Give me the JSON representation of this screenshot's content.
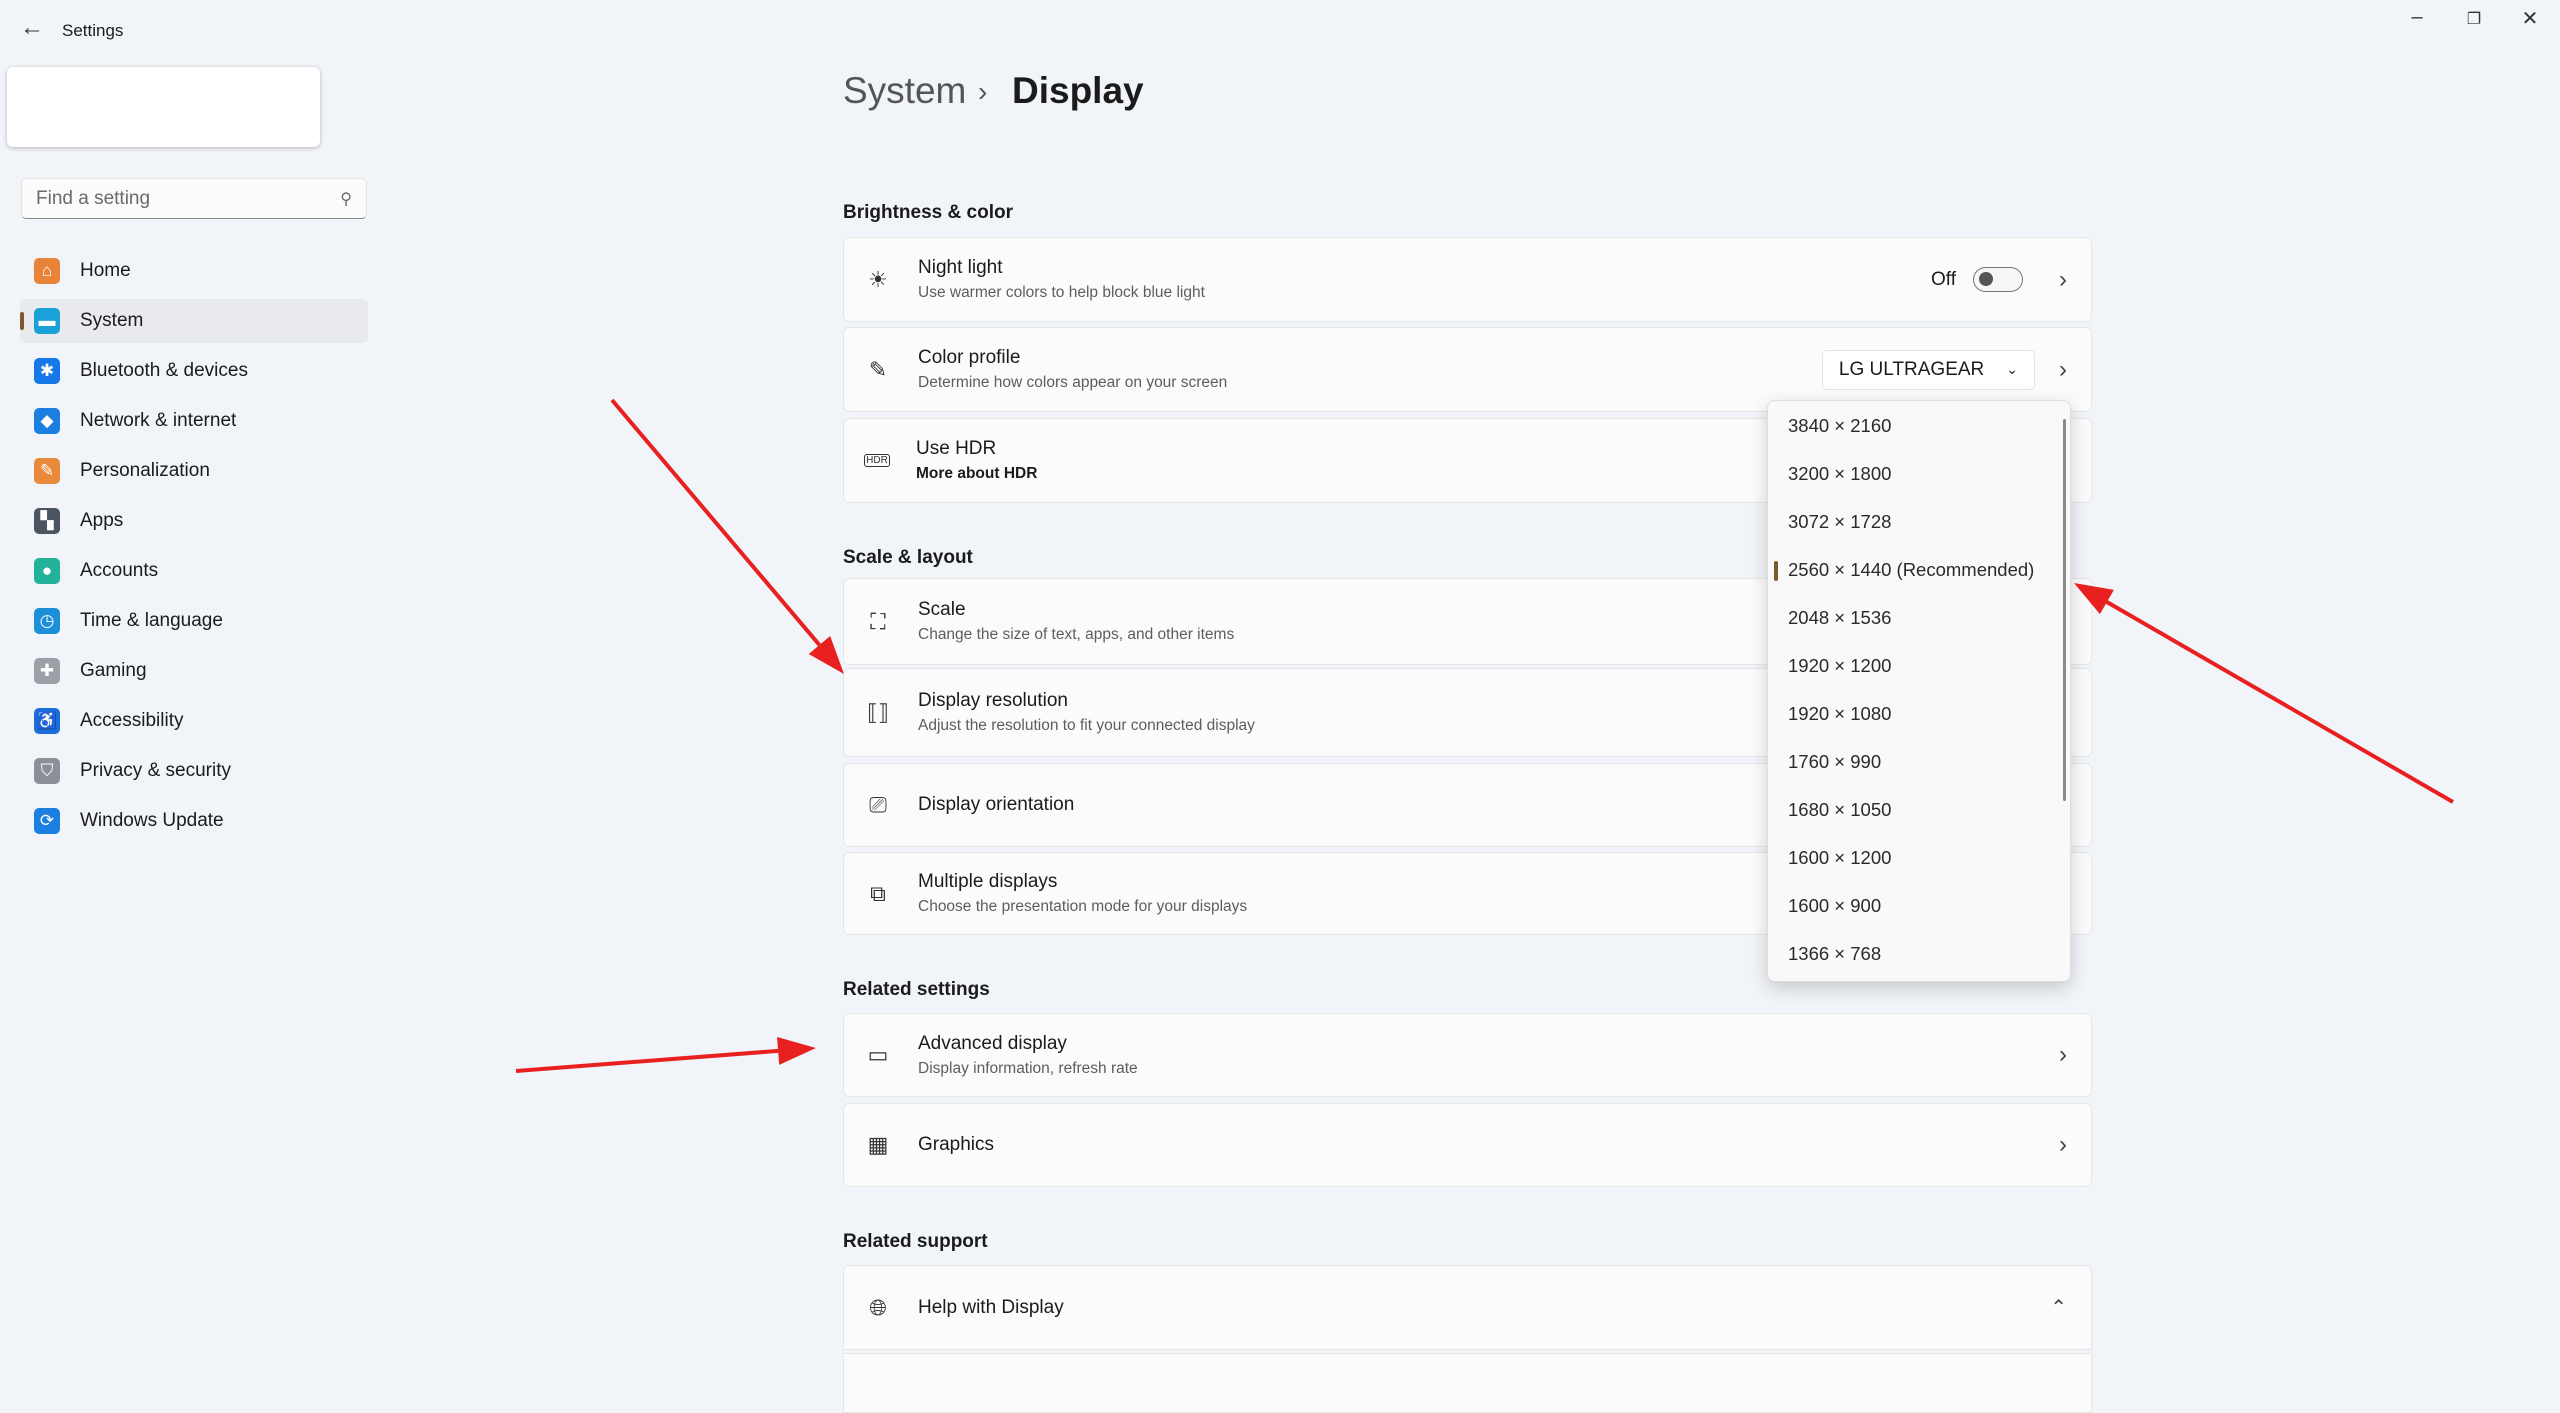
{
  "window": {
    "title": "Settings",
    "minimize": "–",
    "restore": "❐",
    "close": "✕"
  },
  "search": {
    "placeholder": "Find a setting"
  },
  "sidebar": {
    "items": [
      {
        "label": "Home",
        "icon": "home-icon",
        "color": "#e8833a"
      },
      {
        "label": "System",
        "icon": "system-icon",
        "color": "#1aa1d8"
      },
      {
        "label": "Bluetooth & devices",
        "icon": "bluetooth-icon",
        "color": "#1677e8"
      },
      {
        "label": "Network & internet",
        "icon": "wifi-icon",
        "color": "#1a7fe0"
      },
      {
        "label": "Personalization",
        "icon": "brush-icon",
        "color": "#e88a3a"
      },
      {
        "label": "Apps",
        "icon": "apps-icon",
        "color": "#4a5560"
      },
      {
        "label": "Accounts",
        "icon": "accounts-icon",
        "color": "#22b39a"
      },
      {
        "label": "Time & language",
        "icon": "globe-clock-icon",
        "color": "#1d8fd8"
      },
      {
        "label": "Gaming",
        "icon": "gamepad-icon",
        "color": "#9aa0a6"
      },
      {
        "label": "Accessibility",
        "icon": "accessibility-icon",
        "color": "#1a6fd8"
      },
      {
        "label": "Privacy & security",
        "icon": "shield-icon",
        "color": "#8a9096"
      },
      {
        "label": "Windows Update",
        "icon": "update-icon",
        "color": "#1a7fe0"
      }
    ]
  },
  "breadcrumb": {
    "parent": "System",
    "sep": "›",
    "current": "Display"
  },
  "sections": {
    "brightness": "Brightness & color",
    "scale": "Scale & layout",
    "related": "Related settings",
    "support": "Related support"
  },
  "rows": {
    "night": {
      "title": "Night light",
      "sub": "Use warmer colors to help block blue light",
      "state": "Off"
    },
    "color": {
      "title": "Color profile",
      "sub": "Determine how colors appear on your screen",
      "value": "LG ULTRAGEAR"
    },
    "hdr": {
      "title": "Use HDR",
      "sub": "More about HDR"
    },
    "scale": {
      "title": "Scale",
      "sub": "Change the size of text, apps, and other items"
    },
    "res": {
      "title": "Display resolution",
      "sub": "Adjust the resolution to fit your connected display"
    },
    "orient": {
      "title": "Display orientation"
    },
    "multi": {
      "title": "Multiple displays",
      "sub": "Choose the presentation mode for your displays"
    },
    "adv": {
      "title": "Advanced display",
      "sub": "Display information, refresh rate"
    },
    "graphics": {
      "title": "Graphics"
    },
    "help": {
      "title": "Help with Display"
    }
  },
  "resolution_dropdown": {
    "selected_index": 3,
    "options": [
      "3840 × 2160",
      "3200 × 1800",
      "3072 × 1728",
      "2560 × 1440 (Recommended)",
      "2048 × 1536",
      "1920 × 1200",
      "1920 × 1080",
      "1760 × 990",
      "1680 × 1050",
      "1600 × 1200",
      "1600 × 900",
      "1366 × 768"
    ]
  },
  "annotation_color": "#e82020"
}
